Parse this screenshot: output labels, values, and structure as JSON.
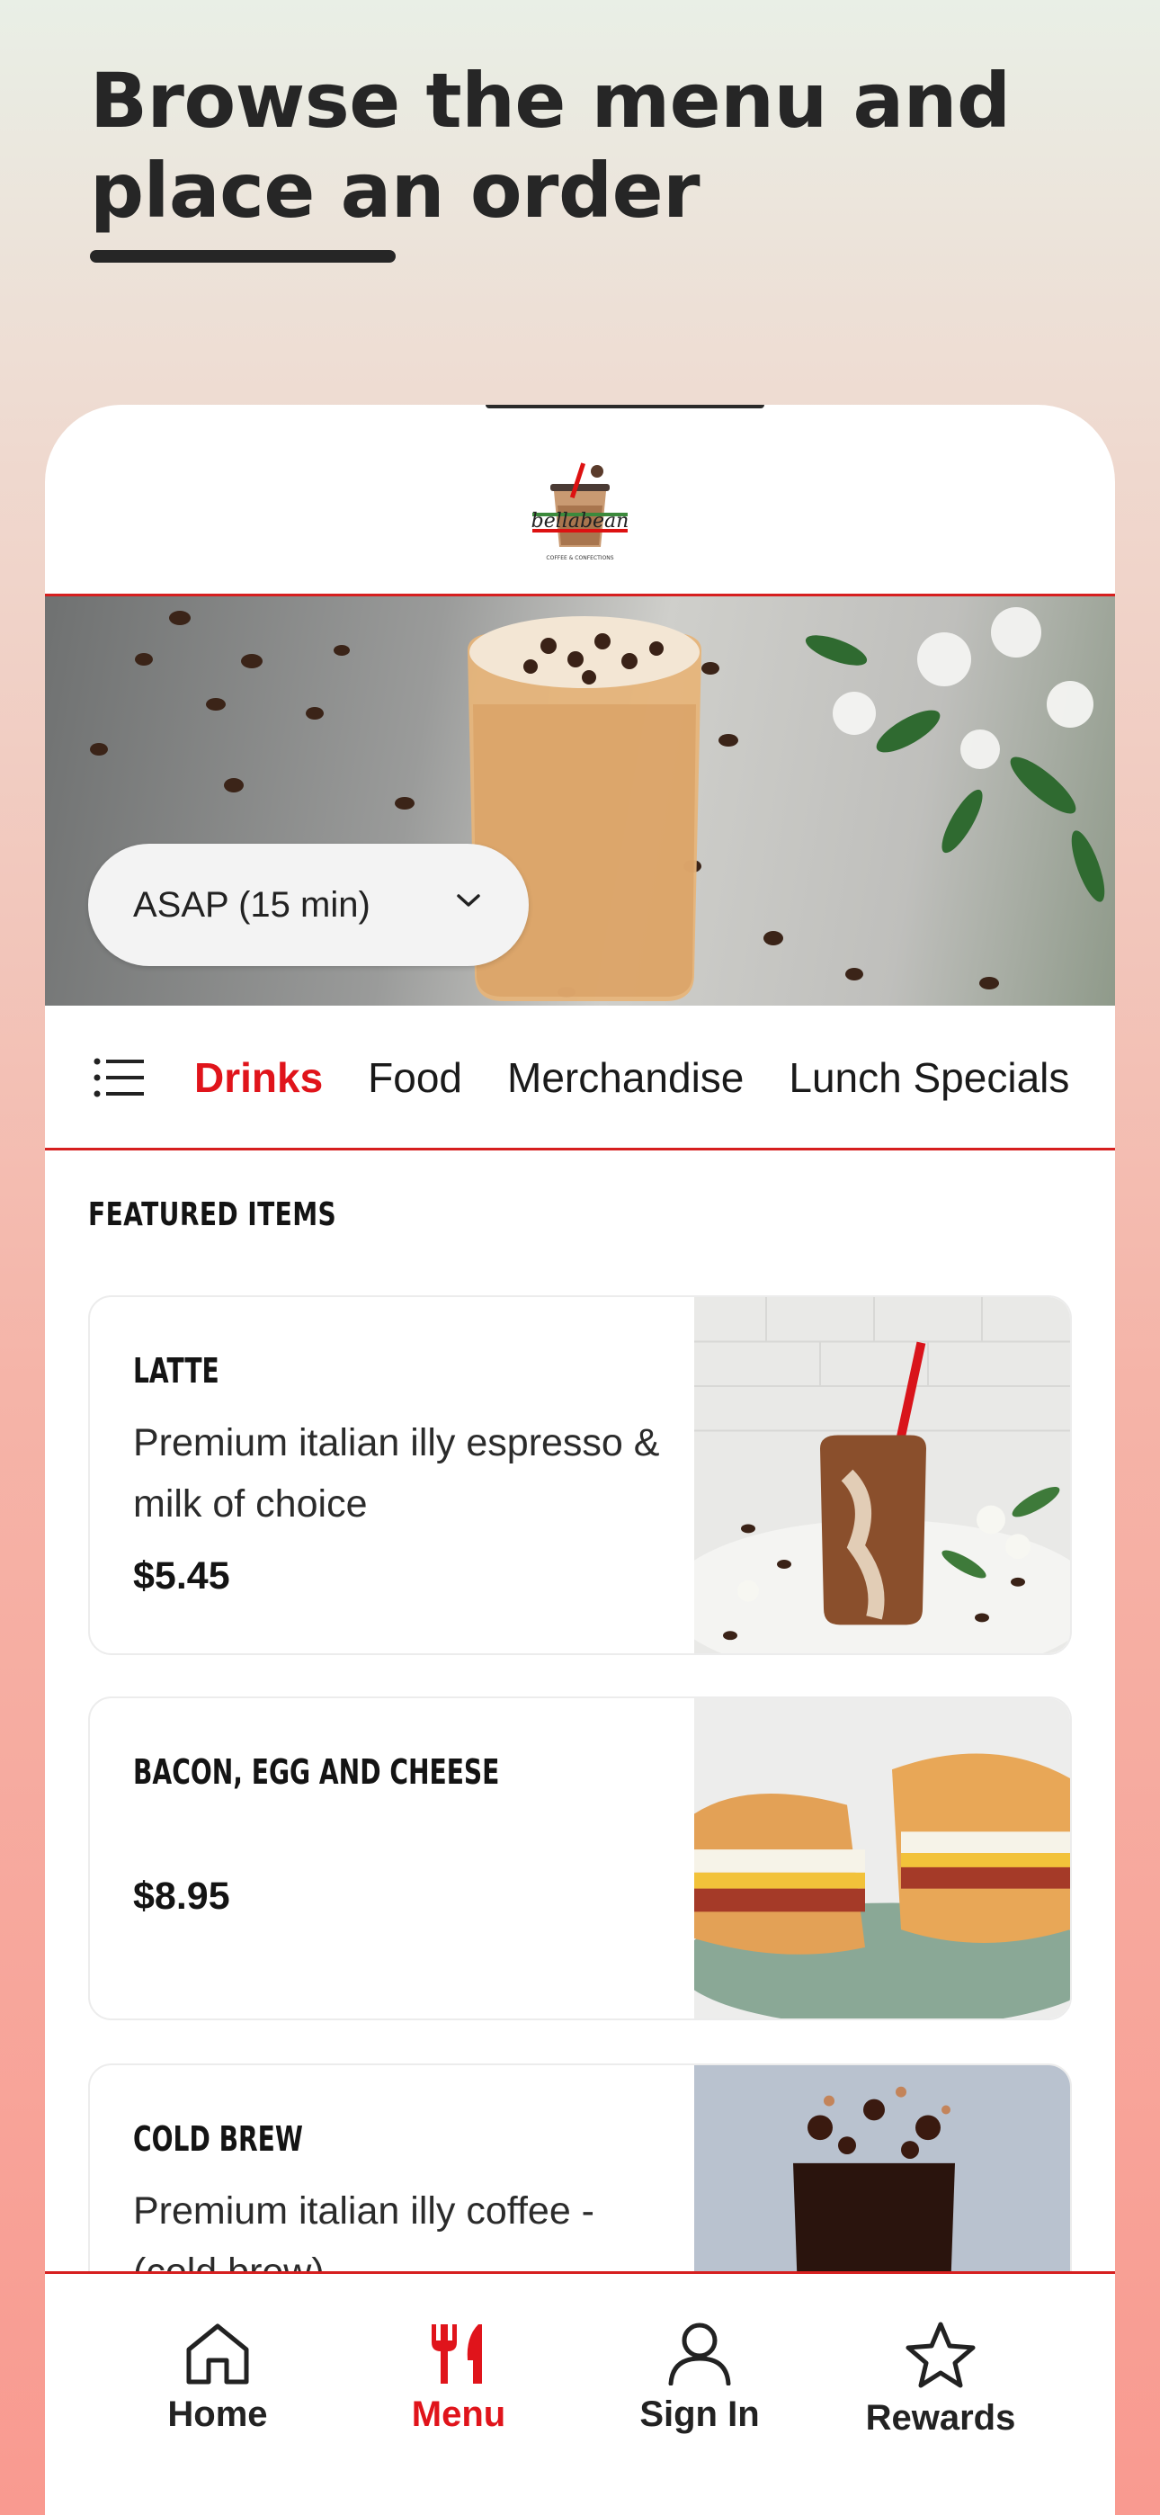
{
  "headline": {
    "line1": "Browse the menu and",
    "line2": "place an order"
  },
  "logo": {
    "text": "bellabean",
    "tagline": "COFFEE & CONFECTIONS"
  },
  "order_time": {
    "value": "ASAP (15 min)"
  },
  "tabs": [
    {
      "label": "Drinks",
      "active": true
    },
    {
      "label": "Food"
    },
    {
      "label": "Merchandise"
    },
    {
      "label": "Lunch Specials"
    }
  ],
  "featured": {
    "title": "FEATURED ITEMS",
    "items": [
      {
        "name": "LATTE",
        "description": "Premium italian illy espresso & milk of choice",
        "price": "$5.45"
      },
      {
        "name": "BACON, EGG AND CHEESE",
        "description": "",
        "price": "$8.95"
      },
      {
        "name": "COLD BREW",
        "description": "Premium italian illy coffee - (cold brew)",
        "price": ""
      }
    ]
  },
  "bottom_nav": [
    {
      "label": "Home",
      "icon": "home-icon"
    },
    {
      "label": "Menu",
      "icon": "fork-knife-icon",
      "active": true
    },
    {
      "label": "Sign In",
      "icon": "person-icon"
    },
    {
      "label": "Rewards",
      "icon": "star-icon"
    }
  ],
  "colors": {
    "accent": "#e0141b",
    "rule": "#d61f1f",
    "text": "#262626"
  }
}
